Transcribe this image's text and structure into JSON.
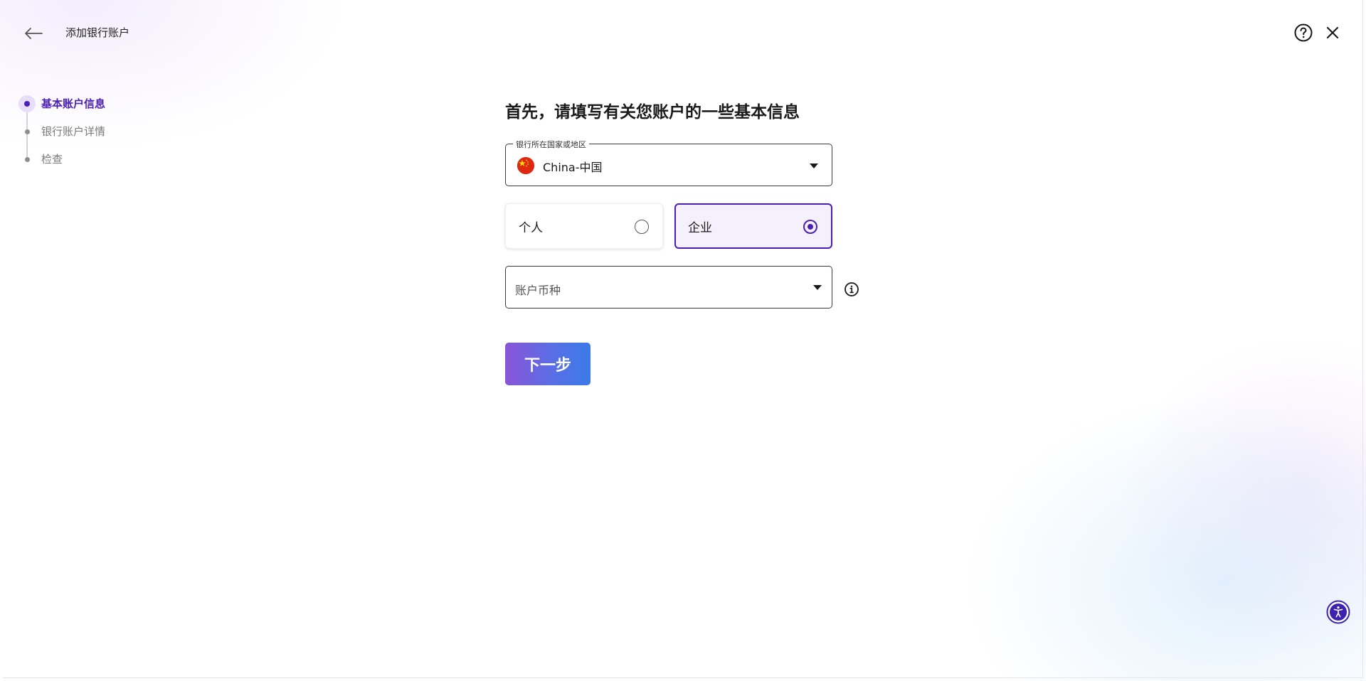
{
  "header": {
    "title": "添加银行账户",
    "back_icon": "arrow-left-icon",
    "help_icon": "question-circle-icon",
    "close_icon": "close-icon"
  },
  "stepper": {
    "steps": [
      {
        "label": "基本账户信息",
        "active": true
      },
      {
        "label": "银行账户详情",
        "active": false
      },
      {
        "label": "检查",
        "active": false
      }
    ]
  },
  "form": {
    "heading": "首先，请填写有关您账户的一些基本信息",
    "country": {
      "label": "银行所在国家或地区",
      "value": "China-中国",
      "flag_icon": "china-flag-icon"
    },
    "account_type": {
      "options": [
        {
          "label": "个人",
          "selected": false
        },
        {
          "label": "企业",
          "selected": true
        }
      ]
    },
    "currency": {
      "placeholder": "账户币种",
      "info_icon": "info-circle-icon"
    },
    "next_label": "下一步"
  },
  "accessibility_icon": "accessibility-icon",
  "colors": {
    "accent": "#4b1fb5",
    "button_gradient_start": "#8a55d6",
    "button_gradient_end": "#3b7be8",
    "flag_red": "#de2910",
    "flag_star": "#ffde00"
  }
}
